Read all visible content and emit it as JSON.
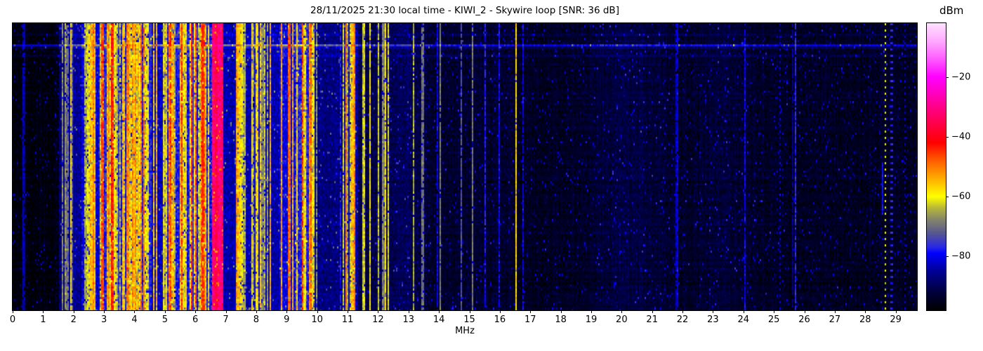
{
  "page": {
    "background": "#ffffff",
    "text_color": "#000000"
  },
  "chart_data": {
    "type": "heatmap",
    "subtype": "radio-spectrum-waterfall",
    "title": "28/11/2025 21:30 local time - KIWI_2 - Skywire loop [SNR: 36 dB]",
    "datetime_local": "28/11/2025 21:30",
    "station": "KIWI_2",
    "antenna": "Skywire loop",
    "snr": "36 dB",
    "xlabel": "MHz",
    "colorbar_label": "dBm",
    "xlim": [
      0,
      29.7
    ],
    "x_ticks": [
      0,
      1,
      2,
      3,
      4,
      5,
      6,
      7,
      8,
      9,
      10,
      11,
      12,
      13,
      14,
      15,
      16,
      17,
      18,
      19,
      20,
      21,
      22,
      23,
      24,
      25,
      26,
      27,
      28,
      29
    ],
    "clim": [
      -98,
      -2
    ],
    "colorbar_ticks": [
      {
        "value": -20,
        "label": "−20"
      },
      {
        "value": -40,
        "label": "−40"
      },
      {
        "value": -60,
        "label": "−60"
      },
      {
        "value": -80,
        "label": "−80"
      }
    ],
    "grid": false,
    "legend": "none",
    "colormap_stops": [
      [
        -98,
        "#000000"
      ],
      [
        -92,
        "#00003c"
      ],
      [
        -85,
        "#000096"
      ],
      [
        -79,
        "#0000ff"
      ],
      [
        -77,
        "#2828e6"
      ],
      [
        -72,
        "#5a5a8c"
      ],
      [
        -68,
        "#82826e"
      ],
      [
        -64,
        "#b4b43c"
      ],
      [
        -60,
        "#ffff00"
      ],
      [
        -53,
        "#ffa000"
      ],
      [
        -47,
        "#ff5000"
      ],
      [
        -42,
        "#ff0000"
      ],
      [
        -35,
        "#ff0050"
      ],
      [
        -28,
        "#ff00a0"
      ],
      [
        -20,
        "#ff00ff"
      ],
      [
        -14,
        "#ff5aff"
      ],
      [
        -8,
        "#ffaaff"
      ],
      [
        -2,
        "#ffe0ff"
      ]
    ],
    "bands": [
      {
        "from": 0.0,
        "to": 1.5,
        "base": -96.5,
        "density": 0.015,
        "cmin": -88,
        "cmax": -82,
        "noise": 2.2
      },
      {
        "from": 1.5,
        "to": 1.85,
        "base": -88,
        "density": 0.45,
        "cmin": -72,
        "cmax": -56,
        "noise": 3.5
      },
      {
        "from": 1.85,
        "to": 2.25,
        "base": -86,
        "density": 0.4,
        "cmin": -75,
        "cmax": -58,
        "noise": 3.5
      },
      {
        "from": 2.25,
        "to": 2.9,
        "base": -81,
        "density": 0.55,
        "cmin": -70,
        "cmax": -46,
        "noise": 4.0
      },
      {
        "from": 2.9,
        "to": 4.55,
        "base": -77,
        "density": 0.72,
        "cmin": -66,
        "cmax": -41,
        "noise": 4.5
      },
      {
        "from": 4.55,
        "to": 4.95,
        "base": -83,
        "density": 0.45,
        "cmin": -70,
        "cmax": -50,
        "noise": 4.0
      },
      {
        "from": 4.95,
        "to": 6.55,
        "base": -78,
        "density": 0.7,
        "cmin": -66,
        "cmax": -40,
        "noise": 4.5
      },
      {
        "from": 6.55,
        "to": 6.92,
        "base": -36,
        "density": 1.0,
        "cmin": -37,
        "cmax": -30,
        "noise": 3.5
      },
      {
        "from": 6.92,
        "to": 7.35,
        "base": -84,
        "density": 0.25,
        "cmin": -70,
        "cmax": -52,
        "noise": 3.5
      },
      {
        "from": 7.35,
        "to": 7.52,
        "base": -82,
        "density": 0.6,
        "cmin": -60,
        "cmax": -48,
        "noise": 4.0
      },
      {
        "from": 7.52,
        "to": 7.9,
        "base": -84,
        "density": 0.3,
        "cmin": -70,
        "cmax": -54,
        "noise": 3.5
      },
      {
        "from": 7.9,
        "to": 8.4,
        "base": -82,
        "density": 0.55,
        "cmin": -68,
        "cmax": -50,
        "noise": 4.0
      },
      {
        "from": 8.4,
        "to": 8.75,
        "base": -84,
        "density": 0.3,
        "cmin": -66,
        "cmax": -52,
        "noise": 3.5
      },
      {
        "from": 8.75,
        "to": 9.25,
        "base": -80,
        "density": 0.6,
        "cmin": -64,
        "cmax": -45,
        "noise": 4.0
      },
      {
        "from": 9.25,
        "to": 9.9,
        "base": -77,
        "density": 0.75,
        "cmin": -62,
        "cmax": -40,
        "noise": 4.5
      },
      {
        "from": 9.9,
        "to": 10.85,
        "base": -87,
        "density": 0.12,
        "cmin": -78,
        "cmax": -66,
        "noise": 3.5
      },
      {
        "from": 10.85,
        "to": 11.35,
        "base": -84,
        "density": 0.65,
        "cmin": -66,
        "cmax": -44,
        "noise": 4.0
      },
      {
        "from": 11.35,
        "to": 12.2,
        "base": -91,
        "density": 0.18,
        "cmin": -72,
        "cmax": -56,
        "noise": 3.0
      },
      {
        "from": 12.2,
        "to": 13.1,
        "base": -90,
        "density": 0.3,
        "cmin": -70,
        "cmax": -52,
        "noise": 3.0
      },
      {
        "from": 13.1,
        "to": 13.6,
        "base": -91.5,
        "density": 0.25,
        "cmin": -74,
        "cmax": -56,
        "noise": 3.0
      },
      {
        "from": 13.6,
        "to": 16.45,
        "base": -93.5,
        "density": 0.07,
        "cmin": -82,
        "cmax": -68,
        "noise": 2.8
      },
      {
        "from": 16.45,
        "to": 29.7,
        "base": -94.5,
        "density": 0.022,
        "cmin": -86,
        "cmax": -76,
        "noise": 2.6
      }
    ],
    "vertical_lines": [
      {
        "f": 14.05,
        "dbm": -69,
        "dotted": false
      },
      {
        "f": 14.75,
        "dbm": -73,
        "dotted": false
      },
      {
        "f": 15.5,
        "dbm": -78,
        "dotted": false
      },
      {
        "f": 16.0,
        "dbm": -79,
        "dotted": false
      },
      {
        "f": 16.55,
        "dbm": -57,
        "dotted": false
      },
      {
        "f": 16.75,
        "dbm": -80,
        "dotted": false
      },
      {
        "f": 25.2,
        "dbm": -81,
        "dotted": true
      },
      {
        "f": 28.65,
        "dbm": -61,
        "dotted": true
      },
      {
        "f": 28.87,
        "dbm": -77,
        "dotted": true
      },
      {
        "f": 29.3,
        "dbm": -82,
        "dotted": true
      }
    ],
    "segments": [
      {
        "f": 28.55,
        "dbm": -78,
        "from_frac": 0.48,
        "to_frac": 0.66
      }
    ],
    "horizontal_streaks": [
      {
        "row_frac": 0.034,
        "boost": 4
      },
      {
        "row_frac": 0.073,
        "boost": 15
      },
      {
        "row_frac": 0.081,
        "boost": 5
      },
      {
        "row_frac": 0.108,
        "boost": 4
      }
    ],
    "glows": [
      {
        "f": 20.3,
        "sigma": 0.9,
        "boost": 3.2
      },
      {
        "f": 23.4,
        "sigma": 0.7,
        "boost": 1.8
      }
    ],
    "render_seed": 11
  }
}
